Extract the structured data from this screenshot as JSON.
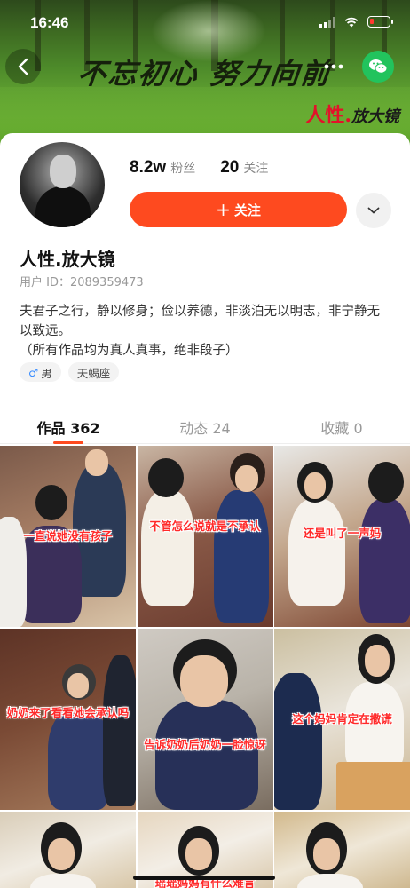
{
  "status_bar": {
    "time": "16:46"
  },
  "banner": {
    "calligraphy": "不忘初心 努力向前",
    "brand_red": "人性.",
    "brand_dark": "放大镜"
  },
  "profile": {
    "followers_count": "8.2w",
    "followers_label": "粉丝",
    "following_count": "20",
    "following_label": "关注",
    "follow_button_plus": "+",
    "follow_button_label": "关注",
    "name": "人性.放大镜",
    "user_id": "用户 ID：2089359473",
    "bio_line1": "夫君子之行，静以修身；俭以养德，非淡泊无以明志，非宁静无以致远。",
    "bio_line2": "（所有作品均为真人真事，绝非段子）",
    "tags": [
      {
        "icon": "male-symbol",
        "symbol": "♂",
        "label": "男"
      },
      {
        "label": "天蝎座"
      }
    ]
  },
  "tabs": [
    {
      "label": "作品 362",
      "active": true
    },
    {
      "label": "动态 24",
      "active": false
    },
    {
      "label": "收藏 0",
      "active": false
    }
  ],
  "videos": [
    {
      "caption": "一直说她没有孩子"
    },
    {
      "caption": "不管怎么说就是不承认"
    },
    {
      "caption": "还是叫了一声妈"
    },
    {
      "caption": "奶奶来了看看她会承认吗"
    },
    {
      "caption": "告诉奶奶后奶奶一脸惊讶"
    },
    {
      "caption": "这个妈妈肯定在撒谎"
    },
    {
      "caption": ""
    },
    {
      "caption": "瑶瑶妈妈有什么难言"
    },
    {
      "caption": ""
    }
  ],
  "colors": {
    "accent": "#fe4a1f",
    "caption": "#ff2a2a",
    "wechat": "#22c35d"
  }
}
